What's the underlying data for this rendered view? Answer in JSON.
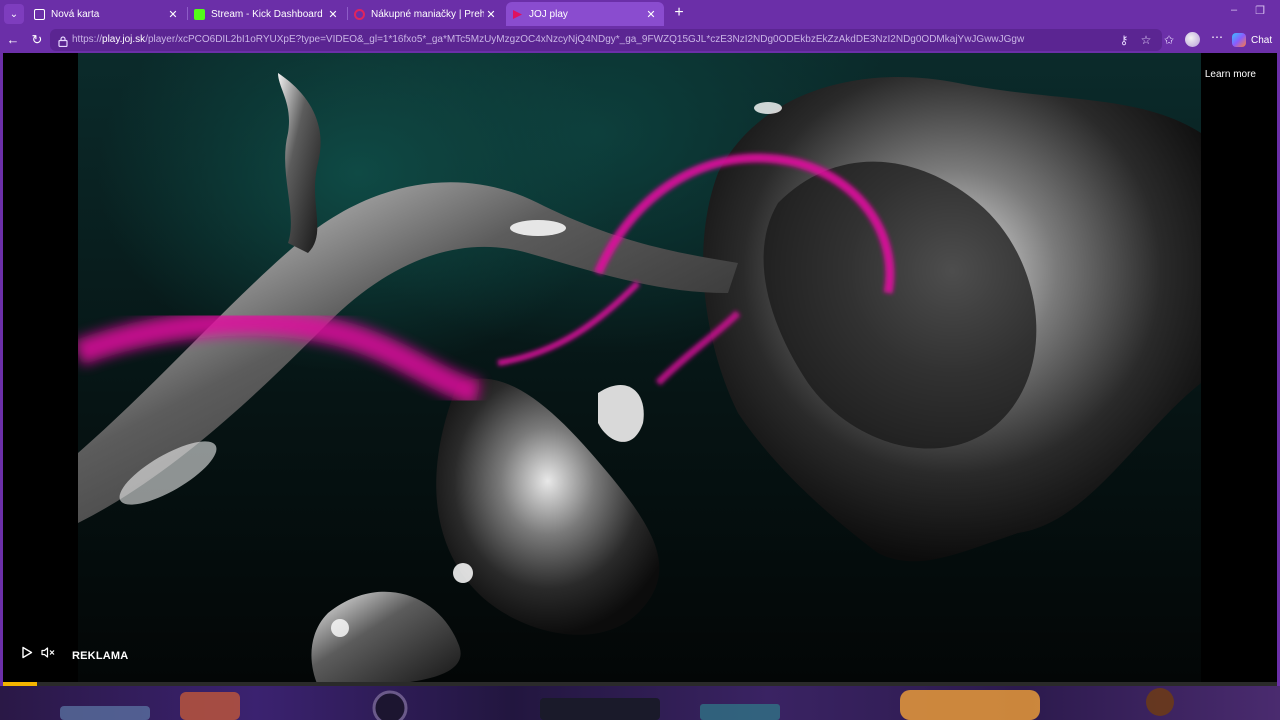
{
  "browser": {
    "tabs": [
      {
        "label": "Nová karta",
        "favicon_color": "#ffffff"
      },
      {
        "label": "Stream - Kick Dashboard",
        "favicon_color": "#53fc18"
      },
      {
        "label": "Nákupné maniačky | Prehľad | Arc",
        "favicon_color": "#e0245e"
      },
      {
        "label": "JOJ play",
        "favicon_color": "#e0115f"
      }
    ],
    "address": {
      "url_prefix": "https://",
      "url_host": "play.joj.sk",
      "url_rest": "/player/xcPCO6DIL2bI1oRYUXpE?type=VIDEO&_gl=1*16fxo5*_ga*MTc5MzUyMzgzOC4xNzcyNjQ4NDgy*_ga_9FWZQ15GJL*czE3NzI2NDg0ODEkbzEkZzAkdDE3NzI2NDg0ODMkajYwJGwwJGgw"
    },
    "chat_label": "Chat"
  },
  "player": {
    "learn_more": "Learn more",
    "ad_label": "REKLAMA",
    "progress": 0.027
  },
  "colors": {
    "browser_frame": "#6b2fa8",
    "accent_magenta": "#e0119f",
    "progress": "#f4b400"
  },
  "icons": [
    "tab-menu-icon",
    "close-icon",
    "new-tab-icon",
    "back-icon",
    "reload-icon",
    "site-info-icon",
    "key-icon",
    "star-icon",
    "favorites-icon",
    "profile-avatar",
    "more-icon",
    "copilot-icon",
    "play-icon",
    "mute-icon"
  ]
}
